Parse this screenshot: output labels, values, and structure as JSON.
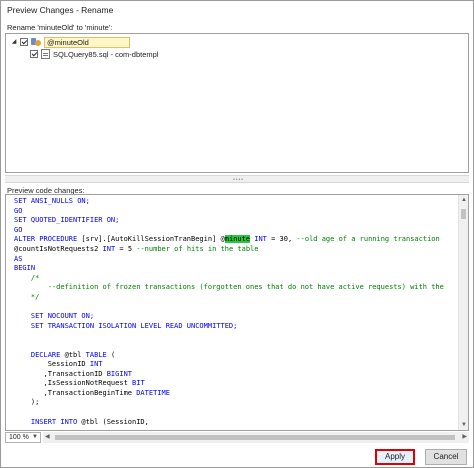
{
  "window": {
    "title": "Preview Changes - Rename"
  },
  "rename_label": "Rename 'minuteOld' to 'minute':",
  "tree": {
    "items": [
      {
        "label": "@minuteOld",
        "checked": true,
        "expanded": true
      },
      {
        "label": "SQLQuery85.sql - com-dbtempl",
        "checked": true
      }
    ]
  },
  "preview_label": "Preview code changes:",
  "code": {
    "lines": [
      [
        {
          "t": "SET ANSI_NULLS ON;",
          "c": "kw"
        }
      ],
      [
        {
          "t": "GO",
          "c": "kw"
        }
      ],
      [
        {
          "t": "SET QUOTED_IDENTIFIER ON;",
          "c": "kw"
        }
      ],
      [
        {
          "t": "GO",
          "c": "kw"
        }
      ],
      [
        {
          "t": "ALTER PROCEDURE",
          "c": "kw"
        },
        {
          "t": " [srv].[AutoKillSessionTranBegin] @"
        },
        {
          "t": "minute",
          "c": "hl"
        },
        {
          "t": " "
        },
        {
          "t": "INT",
          "c": "kw"
        },
        {
          "t": " = 30, "
        },
        {
          "t": "--old age of a running transaction",
          "c": "cm"
        }
      ],
      [
        {
          "t": "@countIsNotRequests2 "
        },
        {
          "t": "INT",
          "c": "kw"
        },
        {
          "t": " = 5 "
        },
        {
          "t": "--number of hits in the table",
          "c": "cm"
        }
      ],
      [
        {
          "t": "AS",
          "c": "kw"
        }
      ],
      [
        {
          "t": "BEGIN",
          "c": "kw"
        }
      ],
      [
        {
          "t": "    /*",
          "c": "cm"
        }
      ],
      [
        {
          "t": "        --definition of frozen transactions (forgotten ones that do not have active requests) with the",
          "c": "cm"
        }
      ],
      [
        {
          "t": "    */",
          "c": "cm"
        }
      ],
      [
        {
          "t": ""
        }
      ],
      [
        {
          "t": "    "
        },
        {
          "t": "SET NOCOUNT ON;",
          "c": "kw"
        }
      ],
      [
        {
          "t": "    "
        },
        {
          "t": "SET TRANSACTION ISOLATION LEVEL READ UNCOMMITTED;",
          "c": "kw"
        }
      ],
      [
        {
          "t": ""
        }
      ],
      [
        {
          "t": ""
        }
      ],
      [
        {
          "t": "    "
        },
        {
          "t": "DECLARE",
          "c": "kw"
        },
        {
          "t": " @tbl "
        },
        {
          "t": "TABLE",
          "c": "kw"
        },
        {
          "t": " ("
        }
      ],
      [
        {
          "t": "        SessionID "
        },
        {
          "t": "INT",
          "c": "kw"
        }
      ],
      [
        {
          "t": "       ,TransactionID "
        },
        {
          "t": "BIGINT",
          "c": "kw"
        }
      ],
      [
        {
          "t": "       ,IsSessionNotRequest "
        },
        {
          "t": "BIT",
          "c": "kw"
        }
      ],
      [
        {
          "t": "       ,TransactionBeginTime "
        },
        {
          "t": "DATETIME",
          "c": "kw"
        }
      ],
      [
        {
          "t": "    );"
        }
      ],
      [
        {
          "t": ""
        }
      ],
      [
        {
          "t": "    "
        },
        {
          "t": "INSERT INTO",
          "c": "kw"
        },
        {
          "t": " @tbl (SessionID,"
        }
      ]
    ]
  },
  "zoom": "100 %",
  "buttons": {
    "apply": "Apply",
    "cancel": "Cancel"
  }
}
